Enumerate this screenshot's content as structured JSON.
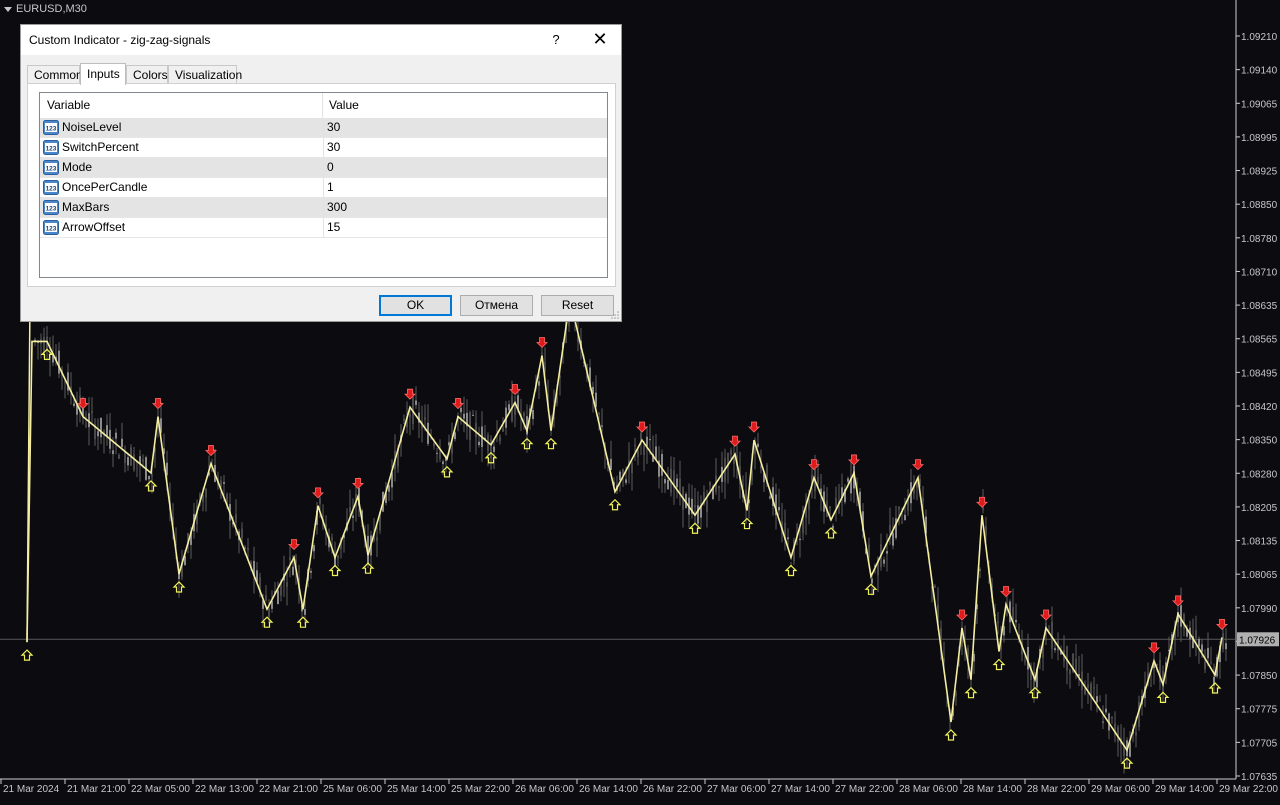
{
  "chart": {
    "symbol": "EURUSD,M30",
    "current_price": "1.07926",
    "price_labels": [
      "1.09210",
      "1.09140",
      "1.09065",
      "1.08995",
      "1.08925",
      "1.08850",
      "1.08780",
      "1.08710",
      "1.08635",
      "1.08565",
      "1.08495",
      "1.08420",
      "1.08350",
      "1.08280",
      "1.08205",
      "1.08135",
      "1.08065",
      "1.07990",
      "1.07920",
      "1.07850",
      "1.07775",
      "1.07705",
      "1.07635"
    ],
    "time_labels": [
      "21 Mar 2024",
      "21 Mar 21:00",
      "22 Mar 05:00",
      "22 Mar 13:00",
      "22 Mar 21:00",
      "25 Mar 06:00",
      "25 Mar 14:00",
      "25 Mar 22:00",
      "26 Mar 06:00",
      "26 Mar 14:00",
      "26 Mar 22:00",
      "27 Mar 06:00",
      "27 Mar 14:00",
      "27 Mar 22:00",
      "28 Mar 06:00",
      "28 Mar 14:00",
      "28 Mar 22:00",
      "29 Mar 06:00",
      "29 Mar 14:00",
      "29 Mar 22:00"
    ],
    "colors": {
      "background": "#0b0b10",
      "axis_text": "#c8c8c8",
      "zigzag": "#f5eea0",
      "arrow_up": "#f2f25a",
      "arrow_down": "#e01b1b",
      "candles": "#7a7a7a"
    },
    "zigzag": [
      [
        1.0792,
        "low"
      ],
      [
        1.0856,
        "low"
      ],
      [
        1.0856,
        "low"
      ],
      [
        1.084,
        "high"
      ],
      [
        1.0828,
        "low"
      ],
      [
        1.084,
        "high"
      ],
      [
        1.08065,
        "low"
      ],
      [
        1.083,
        "high"
      ],
      [
        1.0799,
        "low"
      ],
      [
        1.081,
        "high"
      ],
      [
        1.0799,
        "low"
      ],
      [
        1.0821,
        "high"
      ],
      [
        1.081,
        "low"
      ],
      [
        1.0823,
        "high"
      ],
      [
        1.08105,
        "low"
      ],
      [
        1.0842,
        "high"
      ],
      [
        1.0831,
        "low"
      ],
      [
        1.084,
        "high"
      ],
      [
        1.0834,
        "low"
      ],
      [
        1.0843,
        "high"
      ],
      [
        1.0837,
        "low"
      ],
      [
        1.0853,
        "high"
      ],
      [
        1.0837,
        "low"
      ],
      [
        1.0865,
        "high"
      ],
      [
        1.0824,
        "low"
      ],
      [
        1.0835,
        "high"
      ],
      [
        1.0819,
        "low"
      ],
      [
        1.0832,
        "high"
      ],
      [
        1.082,
        "low"
      ],
      [
        1.0835,
        "high"
      ],
      [
        1.081,
        "low"
      ],
      [
        1.0827,
        "high"
      ],
      [
        1.0818,
        "low"
      ],
      [
        1.0828,
        "high"
      ],
      [
        1.0806,
        "low"
      ],
      [
        1.0827,
        "high"
      ],
      [
        1.0775,
        "low"
      ],
      [
        1.0795,
        "high"
      ],
      [
        1.0784,
        "low"
      ],
      [
        1.0819,
        "high"
      ],
      [
        1.079,
        "low"
      ],
      [
        1.08,
        "high"
      ],
      [
        1.0784,
        "low"
      ],
      [
        1.0795,
        "high"
      ],
      [
        1.0769,
        "low"
      ],
      [
        1.0788,
        "high"
      ],
      [
        1.0783,
        "low"
      ],
      [
        1.0798,
        "high"
      ],
      [
        1.0785,
        "low"
      ],
      [
        1.0793,
        "high"
      ]
    ]
  },
  "dialog": {
    "title": "Custom Indicator - zig-zag-signals",
    "help_label": "?",
    "close_label": "✕",
    "tabs": [
      {
        "label": "Common",
        "active": false
      },
      {
        "label": "Inputs",
        "active": true
      },
      {
        "label": "Colors",
        "active": false
      },
      {
        "label": "Visualization",
        "active": false
      }
    ],
    "columns": {
      "variable": "Variable",
      "value": "Value"
    },
    "params": [
      {
        "name": "NoiseLevel",
        "value": "30"
      },
      {
        "name": "SwitchPercent",
        "value": "30"
      },
      {
        "name": "Mode",
        "value": "0"
      },
      {
        "name": "OncePerCandle",
        "value": "1"
      },
      {
        "name": "MaxBars",
        "value": "300"
      },
      {
        "name": "ArrowOffset",
        "value": "15"
      }
    ],
    "param_icon": "numeric-123-icon",
    "buttons": {
      "ok": "OK",
      "cancel": "Отмена",
      "reset": "Reset"
    }
  }
}
